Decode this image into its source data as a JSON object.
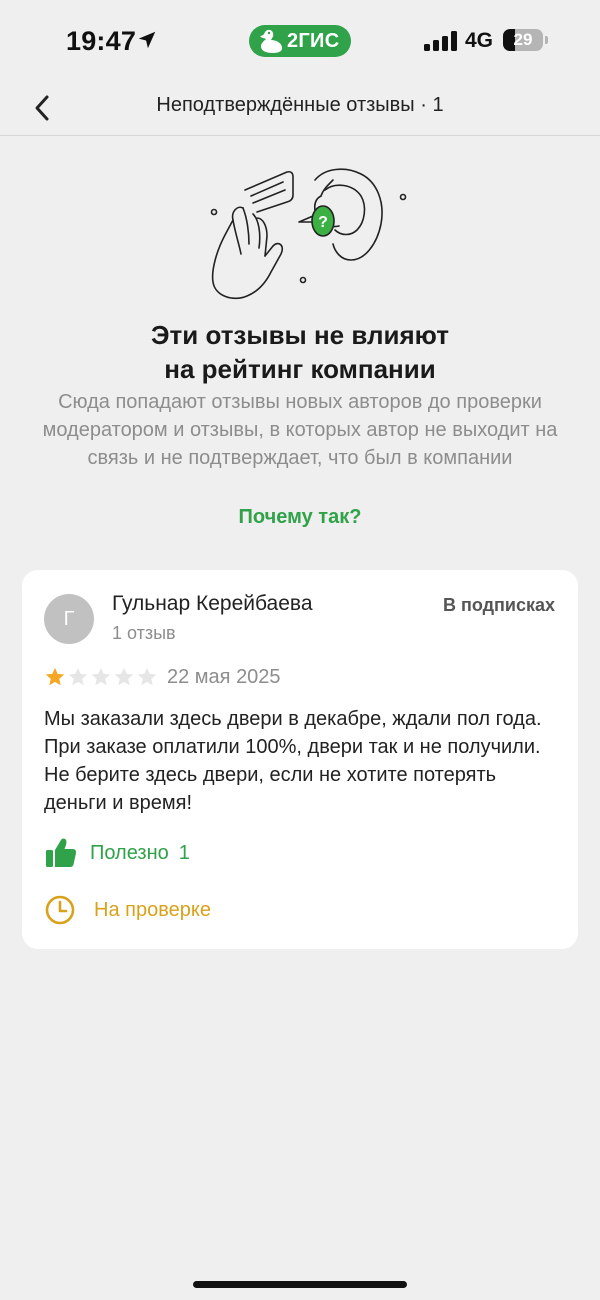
{
  "status_bar": {
    "time": "19:47",
    "location_icon": "location-arrow-icon",
    "app_badge": "2ГИС",
    "app_badge_color": "#2fa24a",
    "network": "4G",
    "battery_level": "29",
    "battery_fraction": 0.29
  },
  "nav": {
    "back_icon": "chevron-left-icon",
    "title": "Неподтверждённые отзывы · 1"
  },
  "info": {
    "illustration_icon": "hands-question-illustration",
    "heading_line1": "Эти отзывы не влияют",
    "heading_line2": "на рейтинг компании",
    "description": "Сюда попадают отзывы новых авторов до проверки модератором и отзывы, в которых автор не выходит на связь и не подтверждает, что был в компании",
    "why_link": "Почему так?"
  },
  "review": {
    "avatar_letter": "Г",
    "author_name": "Гульнар Керейбаева",
    "author_reviews": "1 отзыв",
    "subscription_label": "В подписках",
    "rating": 1,
    "rating_max": 5,
    "date": "22 мая 2025",
    "text": "Мы заказали здесь двери в декабре, ждали пол года. При заказе оплатили 100%, двери так и не получили. Не берите здесь двери, если не хотите потерять деньги и время!",
    "helpful_label": "Полезно",
    "helpful_count": "1",
    "moderation_label": "На проверке"
  },
  "colors": {
    "accent_green": "#2fa24a",
    "star_active": "#f5a623",
    "star_inactive": "#e6e6e6",
    "moderation_yellow": "#d9a21b",
    "background": "#efefef"
  }
}
